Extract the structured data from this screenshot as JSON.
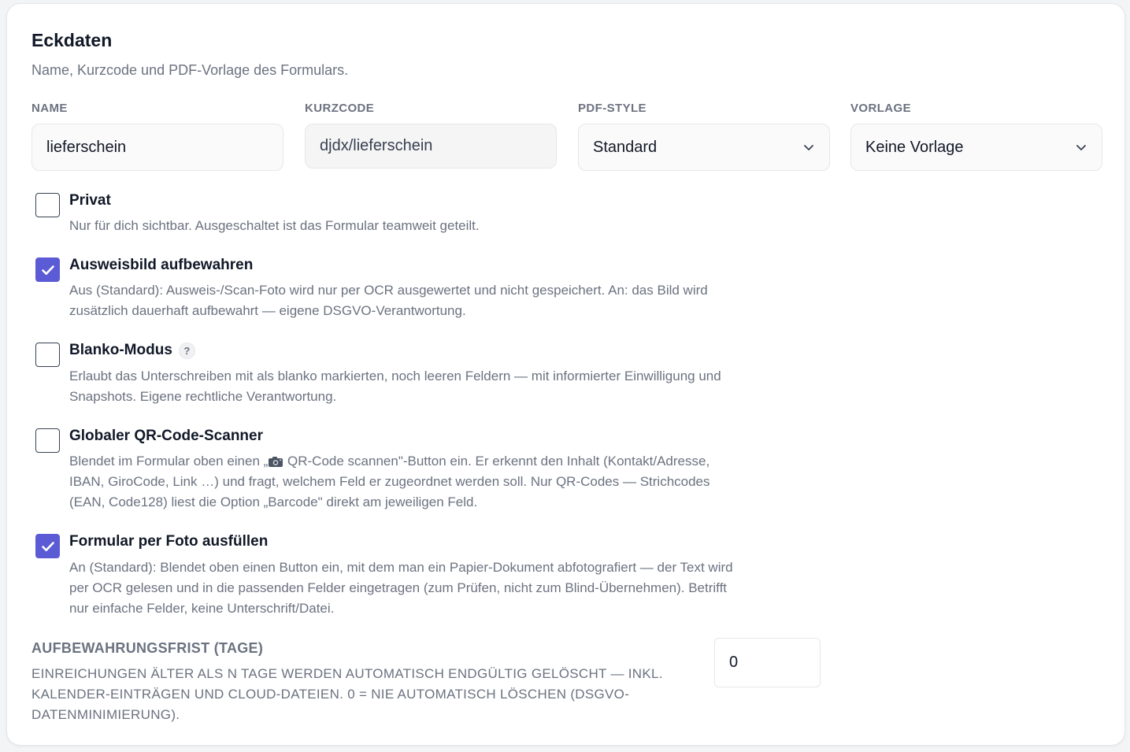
{
  "section": {
    "title": "Eckdaten",
    "subtitle": "Name, Kurzcode und PDF-Vorlage des Formulars."
  },
  "fields": {
    "name": {
      "label": "NAME",
      "value": "lieferschein"
    },
    "kurzcode": {
      "label": "KURZCODE",
      "value": "djdx/lieferschein"
    },
    "pdf_style": {
      "label": "PDF-STYLE",
      "value": "Standard"
    },
    "vorlage": {
      "label": "VORLAGE",
      "value": "Keine Vorlage"
    }
  },
  "options": [
    {
      "title": "Privat",
      "checked": false,
      "desc": "Nur für dich sichtbar. Ausgeschaltet ist das Formular teamweit geteilt."
    },
    {
      "title": "Ausweisbild aufbewahren",
      "checked": true,
      "desc": "Aus (Standard): Ausweis-/Scan-Foto wird nur per OCR ausgewertet und nicht gespeichert. An: das Bild wird zusätzlich dauerhaft aufbewahrt — eigene DSGVO-Verantwortung."
    },
    {
      "title": "Blanko-Modus",
      "checked": false,
      "help": "?",
      "desc": "Erlaubt das Unterschreiben mit als blanko markierten, noch leeren Feldern — mit informierter Einwilligung und Snapshots. Eigene rechtliche Verantwortung."
    },
    {
      "title": "Globaler QR-Code-Scanner",
      "checked": false,
      "desc_before": "Blendet im Formular oben einen „",
      "desc_after": " QR-Code scannen\"-Button ein. Er erkennt den Inhalt (Kontakt/Adresse, IBAN, GiroCode, Link …) und fragt, welchem Feld er zugeordnet werden soll. Nur QR-Codes — Strichcodes (EAN, Code128) liest die Option „Barcode\" direkt am jeweiligen Feld."
    },
    {
      "title": "Formular per Foto ausfüllen",
      "checked": true,
      "desc": "An (Standard): Blendet oben einen Button ein, mit dem man ein Papier-Dokument abfotografiert — der Text wird per OCR gelesen und in die passenden Felder eingetragen (zum Prüfen, nicht zum Blind-Übernehmen). Betrifft nur einfache Felder, keine Unterschrift/Datei."
    }
  ],
  "retention": {
    "label": "AUFBEWAHRUNGSFRIST (TAGE)",
    "desc": "Einreichungen älter als N Tage werden automatisch endgültig gelöscht — inkl. Kalender-Einträgen und Cloud-Dateien. 0 = nie automatisch löschen (DSGVO-Datenminimierung).",
    "value": "0"
  },
  "icons": {
    "chevron": "chevron-down-icon",
    "check": "check-icon",
    "camera": "camera-icon"
  },
  "colors": {
    "accent": "#5b5bd6"
  }
}
